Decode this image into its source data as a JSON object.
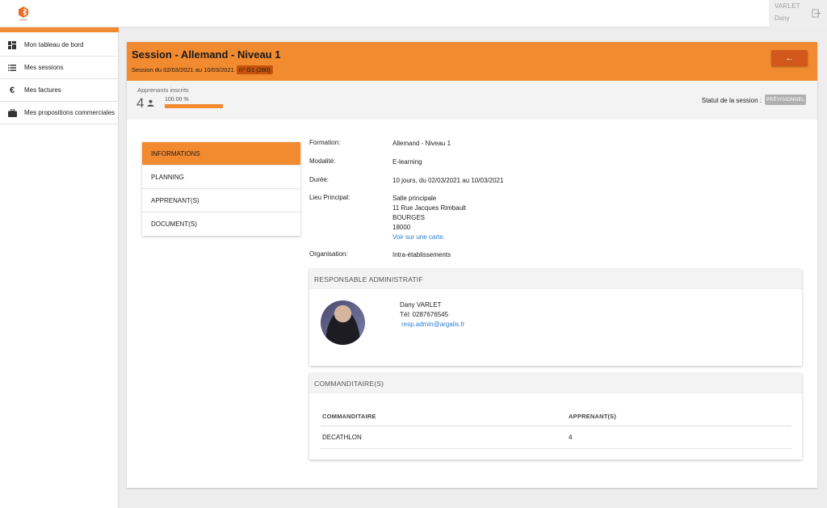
{
  "topbar": {
    "user_last_name": "VARLET",
    "user_first_name": "Dany"
  },
  "sidebar": {
    "items": [
      {
        "label": "Mon tableau de bord",
        "icon": "dashboard-icon"
      },
      {
        "label": "Mes sessions",
        "icon": "list-icon"
      },
      {
        "label": "Mes factures",
        "icon": "euro-icon"
      },
      {
        "label": "Mes propositions commerciales",
        "icon": "briefcase-icon"
      }
    ]
  },
  "header": {
    "title": "Session - Allemand - Niveau 1",
    "dates": "Session du 02/03/2021 au 10/03/2021",
    "badge": "n° G1 (280)",
    "back_icon": "←"
  },
  "stats": {
    "label": "Apprenants inscrits",
    "count": "4",
    "percent_text": "100.00 %",
    "progress": 1.0,
    "status_label": "Statut de la session :",
    "status_value": "PRÉVISIONNEL"
  },
  "tabs": [
    {
      "label": "INFORMATIONS",
      "active": true
    },
    {
      "label": "PLANNING",
      "active": false
    },
    {
      "label": "APPRENANT(S)",
      "active": false
    },
    {
      "label": "DOCUMENT(S)",
      "active": false
    }
  ],
  "info": {
    "formation_label": "Formation:",
    "formation_value": "Allemand - Niveau 1",
    "modalite_label": "Modalité:",
    "modalite_value": "E-learning",
    "duree_label": "Durée:",
    "duree_value": "10 jours, du 02/03/2021 au 10/03/2021",
    "lieu_label": "Lieu Principal:",
    "lieu_line1": "Salle principale",
    "lieu_line2": "11 Rue Jacques Rimbault",
    "lieu_line3": "BOURGES",
    "lieu_line4": "18000",
    "map_link": "Voir sur une carte.",
    "organisation_label": "Organisation:",
    "organisation_value": "Intra-établissements"
  },
  "responsable": {
    "title": "RESPONSABLE ADMINISTRATIF",
    "name": "Dany VARLET",
    "tel": "Tél: 0287676545",
    "email": "resp.admin@argalis.fr"
  },
  "commanditaires": {
    "title": "COMMANDITAIRE(S)",
    "columns": [
      "COMMANDITAIRE",
      "APPRENANT(S)"
    ],
    "rows": [
      [
        "DECATHLON",
        "4"
      ]
    ]
  },
  "colors": {
    "accent": "#f28a30",
    "accent_dark": "#d1581a",
    "link": "#2a7fd4"
  }
}
